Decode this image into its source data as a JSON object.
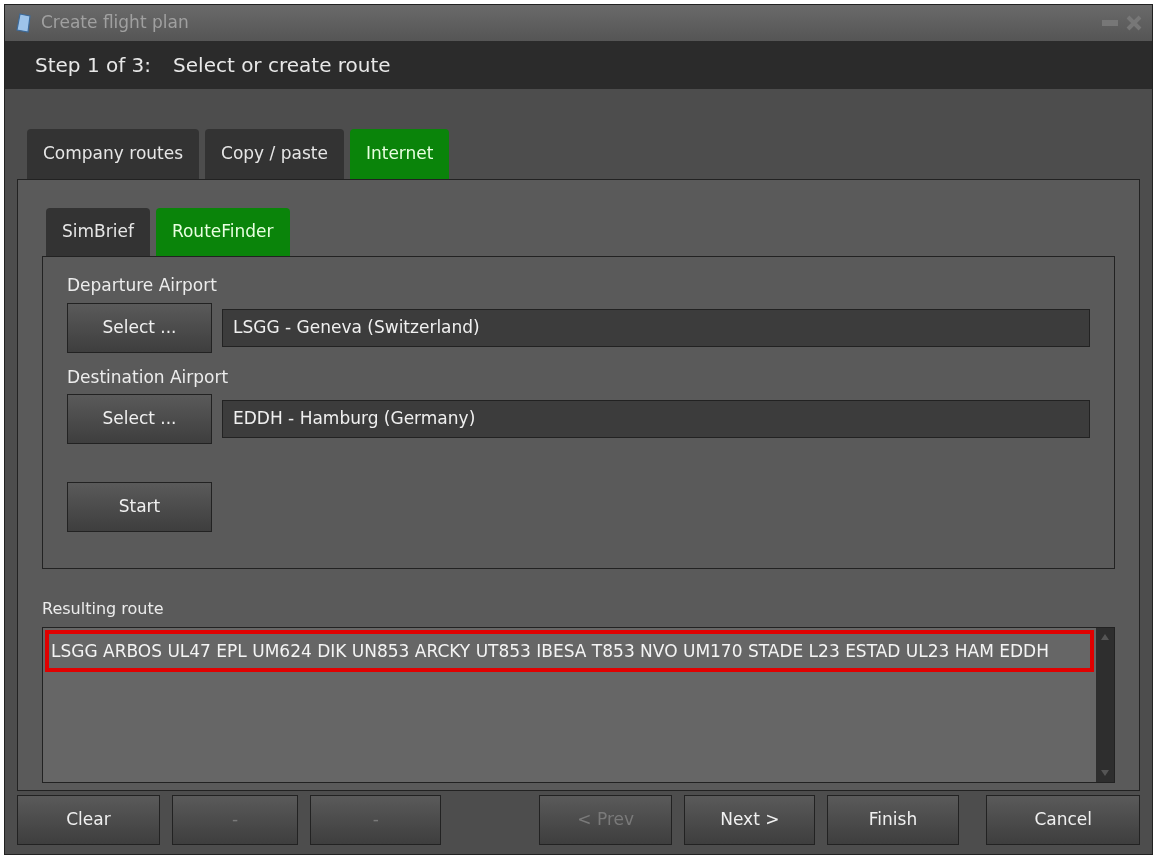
{
  "window": {
    "title": "Create flight plan"
  },
  "step": {
    "number": "Step 1 of 3:",
    "title": "Select or create route"
  },
  "tabs": [
    {
      "label": "Company routes",
      "selected": false
    },
    {
      "label": "Copy / paste",
      "selected": false
    },
    {
      "label": "Internet",
      "selected": true
    }
  ],
  "subtabs": [
    {
      "label": "SimBrief",
      "selected": false
    },
    {
      "label": "RouteFinder",
      "selected": true
    }
  ],
  "airports": [
    {
      "label": "Departure Airport",
      "button": "Select ...",
      "value": "LSGG - Geneva (Switzerland)"
    },
    {
      "label": "Destination Airport",
      "button": "Select ...",
      "value": "EDDH - Hamburg (Germany)"
    }
  ],
  "start_button": "Start",
  "result": {
    "label": "Resulting route",
    "value": "LSGG ARBOS UL47 EPL UM624 DIK UN853 ARCKY UT853 IBESA T853 NVO UM170 STADE L23 ESTAD UL23 HAM EDDH",
    "highlighted": true
  },
  "buttons": [
    {
      "label": "Clear",
      "disabled": false
    },
    {
      "label": "-",
      "disabled": true
    },
    {
      "label": "-",
      "disabled": true
    },
    {
      "label": "< Prev",
      "disabled": true
    },
    {
      "label": "Next >",
      "disabled": false
    },
    {
      "label": "Finish",
      "disabled": false
    },
    {
      "label": "Cancel",
      "disabled": false
    }
  ]
}
